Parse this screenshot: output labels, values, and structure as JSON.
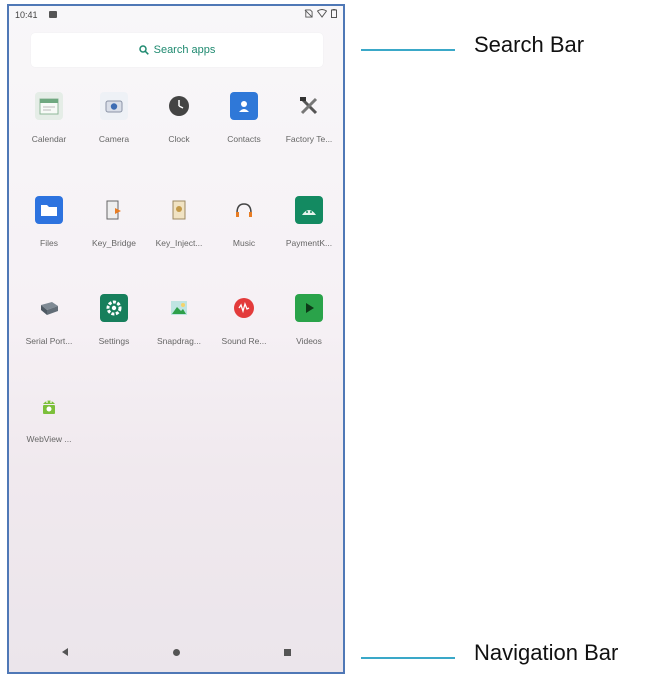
{
  "status": {
    "time": "10:41"
  },
  "search": {
    "placeholder": "Search apps"
  },
  "apps": [
    {
      "label": "Calendar",
      "icon": "calendar-icon",
      "color": "#e9efe9"
    },
    {
      "label": "Camera",
      "icon": "camera-icon",
      "color": "#eef1f6"
    },
    {
      "label": "Clock",
      "icon": "clock-icon",
      "color": "#ffffff"
    },
    {
      "label": "Contacts",
      "icon": "contacts-icon",
      "color": "#2f78d8"
    },
    {
      "label": "Factory Te...",
      "icon": "tools-icon",
      "color": "#ffffff"
    },
    {
      "label": "Files",
      "icon": "folder-icon",
      "color": "#2d73df"
    },
    {
      "label": "Key_Bridge",
      "icon": "key-bridge-icon",
      "color": "#ffffff"
    },
    {
      "label": "Key_Inject...",
      "icon": "key-inject-icon",
      "color": "#ffffff"
    },
    {
      "label": "Music",
      "icon": "headphones-icon",
      "color": "#ffffff"
    },
    {
      "label": "PaymentK...",
      "icon": "android-green-icon",
      "color": "#138a61"
    },
    {
      "label": "Serial Port...",
      "icon": "serial-port-icon",
      "color": "#ffffff"
    },
    {
      "label": "Settings",
      "icon": "gear-icon",
      "color": "#177f5c"
    },
    {
      "label": "Snapdrag...",
      "icon": "image-icon",
      "color": "#ffffff"
    },
    {
      "label": "Sound Re...",
      "icon": "microphone-icon",
      "color": "#e33b3b"
    },
    {
      "label": "Videos",
      "icon": "play-icon",
      "color": "#2aa34a"
    },
    {
      "label": "WebView ...",
      "icon": "android-icon",
      "color": "#7cbf3a"
    }
  ],
  "callouts": {
    "search": "Search Bar",
    "nav": "Navigation Bar"
  }
}
